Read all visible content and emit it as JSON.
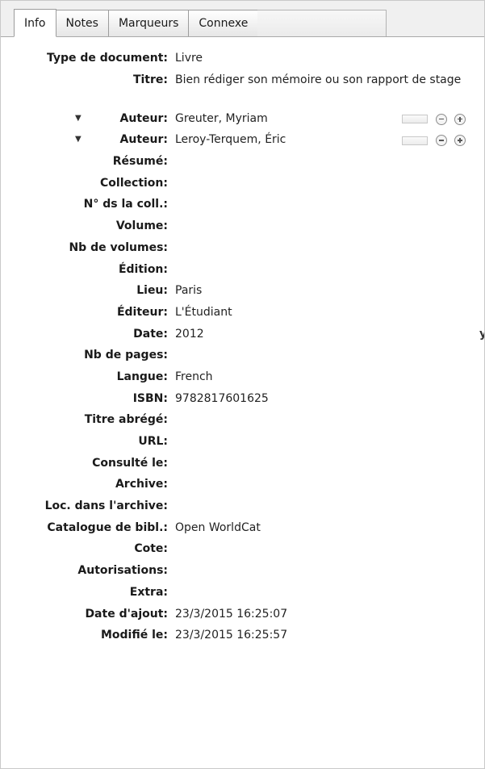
{
  "tabs": [
    {
      "label": "Info",
      "active": true
    },
    {
      "label": "Notes",
      "active": false
    },
    {
      "label": "Marqueurs",
      "active": false
    },
    {
      "label": "Connexe",
      "active": false
    }
  ],
  "fields": {
    "item_type": {
      "label": "Type de document:",
      "value": "Livre"
    },
    "title": {
      "label": "Titre:",
      "value": "Bien rédiger son mémoire ou son rapport de stage"
    },
    "creator1": {
      "label": "Auteur:",
      "value": "Greuter, Myriam"
    },
    "creator2": {
      "label": "Auteur:",
      "value": "Leroy-Terquem, Éric"
    },
    "abstract": {
      "label": "Résumé:",
      "value": ""
    },
    "series": {
      "label": "Collection:",
      "value": ""
    },
    "series_number": {
      "label": "N° ds la coll.:",
      "value": ""
    },
    "volume": {
      "label": "Volume:",
      "value": ""
    },
    "num_volumes": {
      "label": "Nb de volumes:",
      "value": ""
    },
    "edition": {
      "label": "Édition:",
      "value": ""
    },
    "place": {
      "label": "Lieu:",
      "value": "Paris"
    },
    "publisher": {
      "label": "Éditeur:",
      "value": "L'Étudiant"
    },
    "date": {
      "label": "Date:",
      "value": "2012",
      "suffix": "y"
    },
    "num_pages": {
      "label": "Nb de pages:",
      "value": ""
    },
    "language": {
      "label": "Langue:",
      "value": "French"
    },
    "isbn": {
      "label": "ISBN:",
      "value": "9782817601625"
    },
    "short_title": {
      "label": "Titre abrégé:",
      "value": ""
    },
    "url": {
      "label": "URL:",
      "value": ""
    },
    "accessed": {
      "label": "Consulté le:",
      "value": ""
    },
    "archive": {
      "label": "Archive:",
      "value": ""
    },
    "archive_location": {
      "label": "Loc. dans l'archive:",
      "value": ""
    },
    "library_catalog": {
      "label": "Catalogue de bibl.:",
      "value": "Open WorldCat"
    },
    "call_number": {
      "label": "Cote:",
      "value": ""
    },
    "rights": {
      "label": "Autorisations:",
      "value": ""
    },
    "extra": {
      "label": "Extra:",
      "value": ""
    },
    "date_added": {
      "label": "Date d'ajout:",
      "value": "23/3/2015 16:25:07"
    },
    "date_modified": {
      "label": "Modifié le:",
      "value": "23/3/2015 16:25:57"
    }
  },
  "icons": {
    "creator_toggle": "disclosure-triangle-icon",
    "creator_switch": "creator-mode-switch-icon",
    "remove": "minus-circle-icon",
    "add": "plus-circle-icon"
  }
}
